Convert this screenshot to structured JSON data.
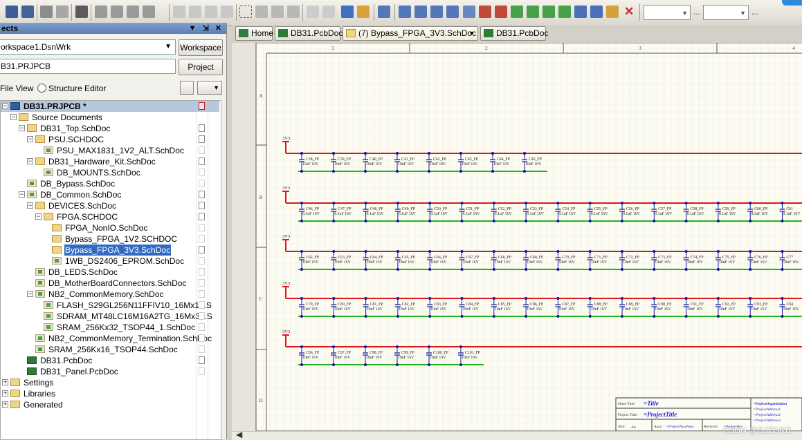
{
  "toolbar": {
    "zoom_combo_value": "",
    "filter_combo_value": "",
    "dots1": "...",
    "dots2": "..."
  },
  "projects_panel": {
    "title": "ects",
    "workspace_value": "orkspace1.DsnWrk",
    "workspace_button": "Workspace",
    "project_value": "B31.PRJPCB",
    "project_button": "Project",
    "file_view_label": "File View",
    "structure_editor_label": "Structure Editor",
    "tree": [
      {
        "label": "DB31.PRJPCB *",
        "icon": "project-icon"
      },
      {
        "label": "Source Documents",
        "icon": "folder-icon"
      },
      {
        "label": "DB31_Top.SchDoc",
        "icon": "folder-icon"
      },
      {
        "label": "PSU.SCHDOC",
        "icon": "folder-icon"
      },
      {
        "label": "PSU_MAX1831_1V2_ALT.SchDoc",
        "icon": "schematic-icon"
      },
      {
        "label": "DB31_Hardware_Kit.SchDoc",
        "icon": "folder-icon"
      },
      {
        "label": "DB_MOUNTS.SchDoc",
        "icon": "schematic-icon"
      },
      {
        "label": "DB_Bypass.SchDoc",
        "icon": "schematic-icon"
      },
      {
        "label": "DB_Common.SchDoc",
        "icon": "schematic-icon"
      },
      {
        "label": "DEVICES.SchDoc",
        "icon": "folder-icon"
      },
      {
        "label": "FPGA.SCHDOC",
        "icon": "folder-icon"
      },
      {
        "label": "FPGA_NonIO.SchDoc",
        "icon": "folder-icon"
      },
      {
        "label": "Bypass_FPGA_1V2.SCHDOC",
        "icon": "folder-icon"
      },
      {
        "label": "Bypass_FPGA_3V3.SchDoc",
        "icon": "folder-icon"
      },
      {
        "label": "1WB_DS2406_EPROM.SchDoc",
        "icon": "schematic-icon"
      },
      {
        "label": "DB_LEDS.SchDoc",
        "icon": "schematic-icon"
      },
      {
        "label": "DB_MotherBoardConnectors.SchDoc",
        "icon": "schematic-icon"
      },
      {
        "label": "NB2_CommonMemory.SchDoc",
        "icon": "schematic-icon"
      },
      {
        "label": "FLASH_S29GL256N11FFIV10_16Mx16.S",
        "icon": "schematic-icon"
      },
      {
        "label": "SDRAM_MT48LC16M16A2TG_16Mx32.S",
        "icon": "schematic-icon"
      },
      {
        "label": "SRAM_256Kx32_TSOP44_1.SchDoc",
        "icon": "schematic-icon"
      },
      {
        "label": "NB2_CommonMemory_Termination.SchDoc",
        "icon": "schematic-icon"
      },
      {
        "label": "SRAM_256Kx16_TSOP44.SchDoc",
        "icon": "schematic-icon"
      },
      {
        "label": "DB31.PcbDoc",
        "icon": "pcb-icon"
      },
      {
        "label": "DB31_Panel.PcbDoc",
        "icon": "pcb-icon"
      },
      {
        "label": "Settings",
        "icon": "folder-icon"
      },
      {
        "label": "Libraries",
        "icon": "folder-icon"
      },
      {
        "label": "Generated",
        "icon": "folder-icon"
      }
    ]
  },
  "tabs": [
    {
      "label": "Home",
      "icon": "home-icon"
    },
    {
      "label": "DB31.PcbDoc",
      "icon": "pcb-icon"
    },
    {
      "label": "(7) Bypass_FPGA_3V3.SchDoc",
      "icon": "schematic-icon"
    },
    {
      "label": "DB31.PcbDoc",
      "icon": "pcb-icon"
    }
  ],
  "sheet": {
    "col_labels": [
      "1",
      "2",
      "3",
      "4"
    ],
    "row_labels": [
      "A",
      "B",
      "C",
      "D"
    ],
    "net_label": "3V3",
    "rows": [
      {
        "caps": [
          "C38_FP",
          "C39_FP",
          "C40_FP",
          "C41_FP",
          "C42_FP",
          "C43_FP",
          "C44_FP",
          "C45_FP"
        ],
        "value": "10uF 10V"
      },
      {
        "caps": [
          "C46_FP",
          "C47_FP",
          "C48_FP",
          "C49_FP",
          "C50_FP",
          "C51_FP",
          "C52_FP",
          "C53_FP",
          "C54_FP",
          "C55_FP",
          "C56_FP",
          "C57_FP",
          "C58_FP",
          "C59_FP",
          "C60_FP",
          "C61"
        ],
        "value": "0.1uF 16V"
      },
      {
        "caps": [
          "C62_FP",
          "C63_FP",
          "C64_FP",
          "C65_FP",
          "C66_FP",
          "C67_FP",
          "C68_FP",
          "C69_FP",
          "C70_FP",
          "C71_FP",
          "C72_FP",
          "C73_FP",
          "C74_FP",
          "C75_FP",
          "C76_FP",
          "C77"
        ],
        "value": "10nF 16V"
      },
      {
        "caps": [
          "C79_FP",
          "C80_FP",
          "C81_FP",
          "C82_FP",
          "C83_FP",
          "C84_FP",
          "C85_FP",
          "C86_FP",
          "C87_FP",
          "C88_FP",
          "C89_FP",
          "C90_FP",
          "C91_FP",
          "C92_FP",
          "C93_FP",
          "C94"
        ],
        "value": "10nF 16V"
      },
      {
        "caps": [
          "C96_FP",
          "C97_FP",
          "C98_FP",
          "C99_FP",
          "C100_FP",
          "C101_FP"
        ],
        "value": "10nF 16V"
      }
    ],
    "title_block": {
      "sheet_title_label": "Sheet Title:",
      "sheet_title_value": "=Title",
      "project_title_label": "Project Title:",
      "project_title_value": "=ProjectTitle",
      "size_label": "Size:",
      "size_value": "A4",
      "assy_label": "Assy :",
      "assy_value": "=ProjectAssyNum",
      "revision_label": "Revision:",
      "revision_value": "=ProjectRev",
      "org": "=ProjectOrganization",
      "address1": "=ProjectAddress1",
      "address2": "=ProjectAddress2",
      "address3": "=ProjectAddress3"
    }
  },
  "watermark": "CSDN @GJZGRB",
  "colors": {
    "power_rail": "#e0141e",
    "ground_rail": "#22b422",
    "wire": "#12129a",
    "selection": "#316ac5"
  }
}
